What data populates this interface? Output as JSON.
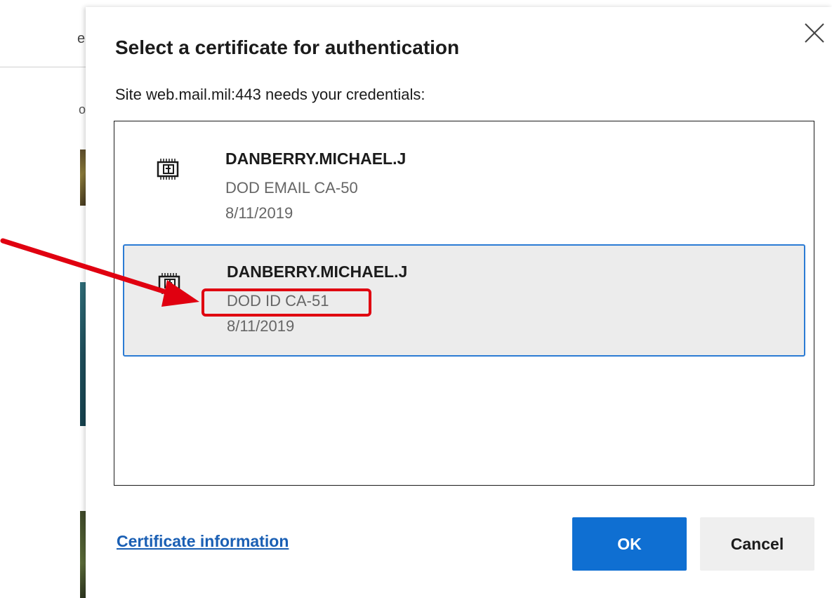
{
  "background": {
    "fragment_1": "e",
    "fragment_2": "o"
  },
  "dialog": {
    "title": "Select a certificate for authentication",
    "subtitle": "Site web.mail.mil:443 needs your credentials:",
    "close_icon": "close-icon",
    "certificates": [
      {
        "name": "DANBERRY.MICHAEL.J",
        "issuer": "DOD EMAIL CA-50",
        "date": "8/11/2019",
        "icon": "certificate-chip-icon",
        "selected": false
      },
      {
        "name": "DANBERRY.MICHAEL.J",
        "issuer": "DOD ID CA-51",
        "date": "8/11/2019",
        "icon": "certificate-chip-icon",
        "selected": true
      }
    ],
    "cert_info_link": "Certificate information",
    "ok_label": "OK",
    "cancel_label": "Cancel"
  },
  "annotation": {
    "color": "#e00010",
    "highlighted_text": "DOD ID CA-51"
  },
  "colors": {
    "accent": "#0f6fd2",
    "selection_border": "#2b7bd4",
    "link": "#1a5fb4"
  }
}
